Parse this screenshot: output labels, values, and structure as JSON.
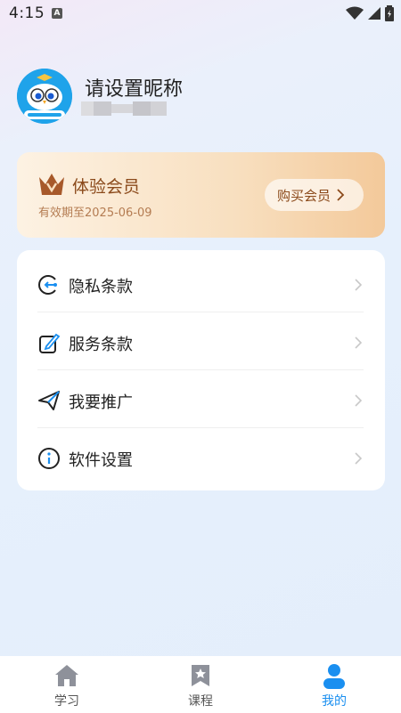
{
  "status_bar": {
    "time": "4:15",
    "notif_letter": "A"
  },
  "profile": {
    "nickname": "请设置昵称"
  },
  "vip": {
    "title": "体验会员",
    "expire": "有效期至2025-06-09",
    "buy_label": "购买会员"
  },
  "menu": {
    "items": [
      {
        "label": "隐私条款",
        "icon": "privacy-icon"
      },
      {
        "label": "服务条款",
        "icon": "service-terms-icon"
      },
      {
        "label": "我要推广",
        "icon": "send-icon"
      },
      {
        "label": "软件设置",
        "icon": "info-icon"
      }
    ]
  },
  "tabbar": {
    "tabs": [
      {
        "label": "学习",
        "icon": "home-icon",
        "active": false
      },
      {
        "label": "课程",
        "icon": "bookmark-icon",
        "active": false
      },
      {
        "label": "我的",
        "icon": "profile-icon",
        "active": true
      }
    ]
  },
  "colors": {
    "accent": "#1a8ff0",
    "vip_text": "#8b4a1b"
  }
}
